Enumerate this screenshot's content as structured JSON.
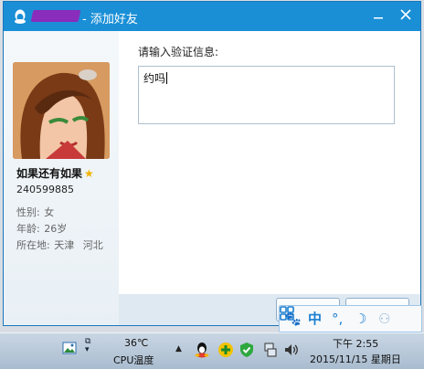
{
  "window": {
    "title": "- 添加好友"
  },
  "profile": {
    "nickname": "如果还有如果",
    "qq_number": "240599885",
    "gender_label": "性别:",
    "gender": "女",
    "age_label": "年龄:",
    "age": "26岁",
    "location_label": "所在地:",
    "city": "天津",
    "province": "河北"
  },
  "main": {
    "prompt": "请输入验证信息:",
    "message": "约吗"
  },
  "taskbar": {
    "temperature": "36℃",
    "cpu_label": "CPU温度",
    "time": "下午 2:55",
    "date": "2015/11/15 星期日"
  },
  "ime": {
    "mode": "中",
    "punct": "°,"
  },
  "colors": {
    "titlebar": "#1a8fd6",
    "accent": "#1a7fd0",
    "star": "#f2b400"
  }
}
